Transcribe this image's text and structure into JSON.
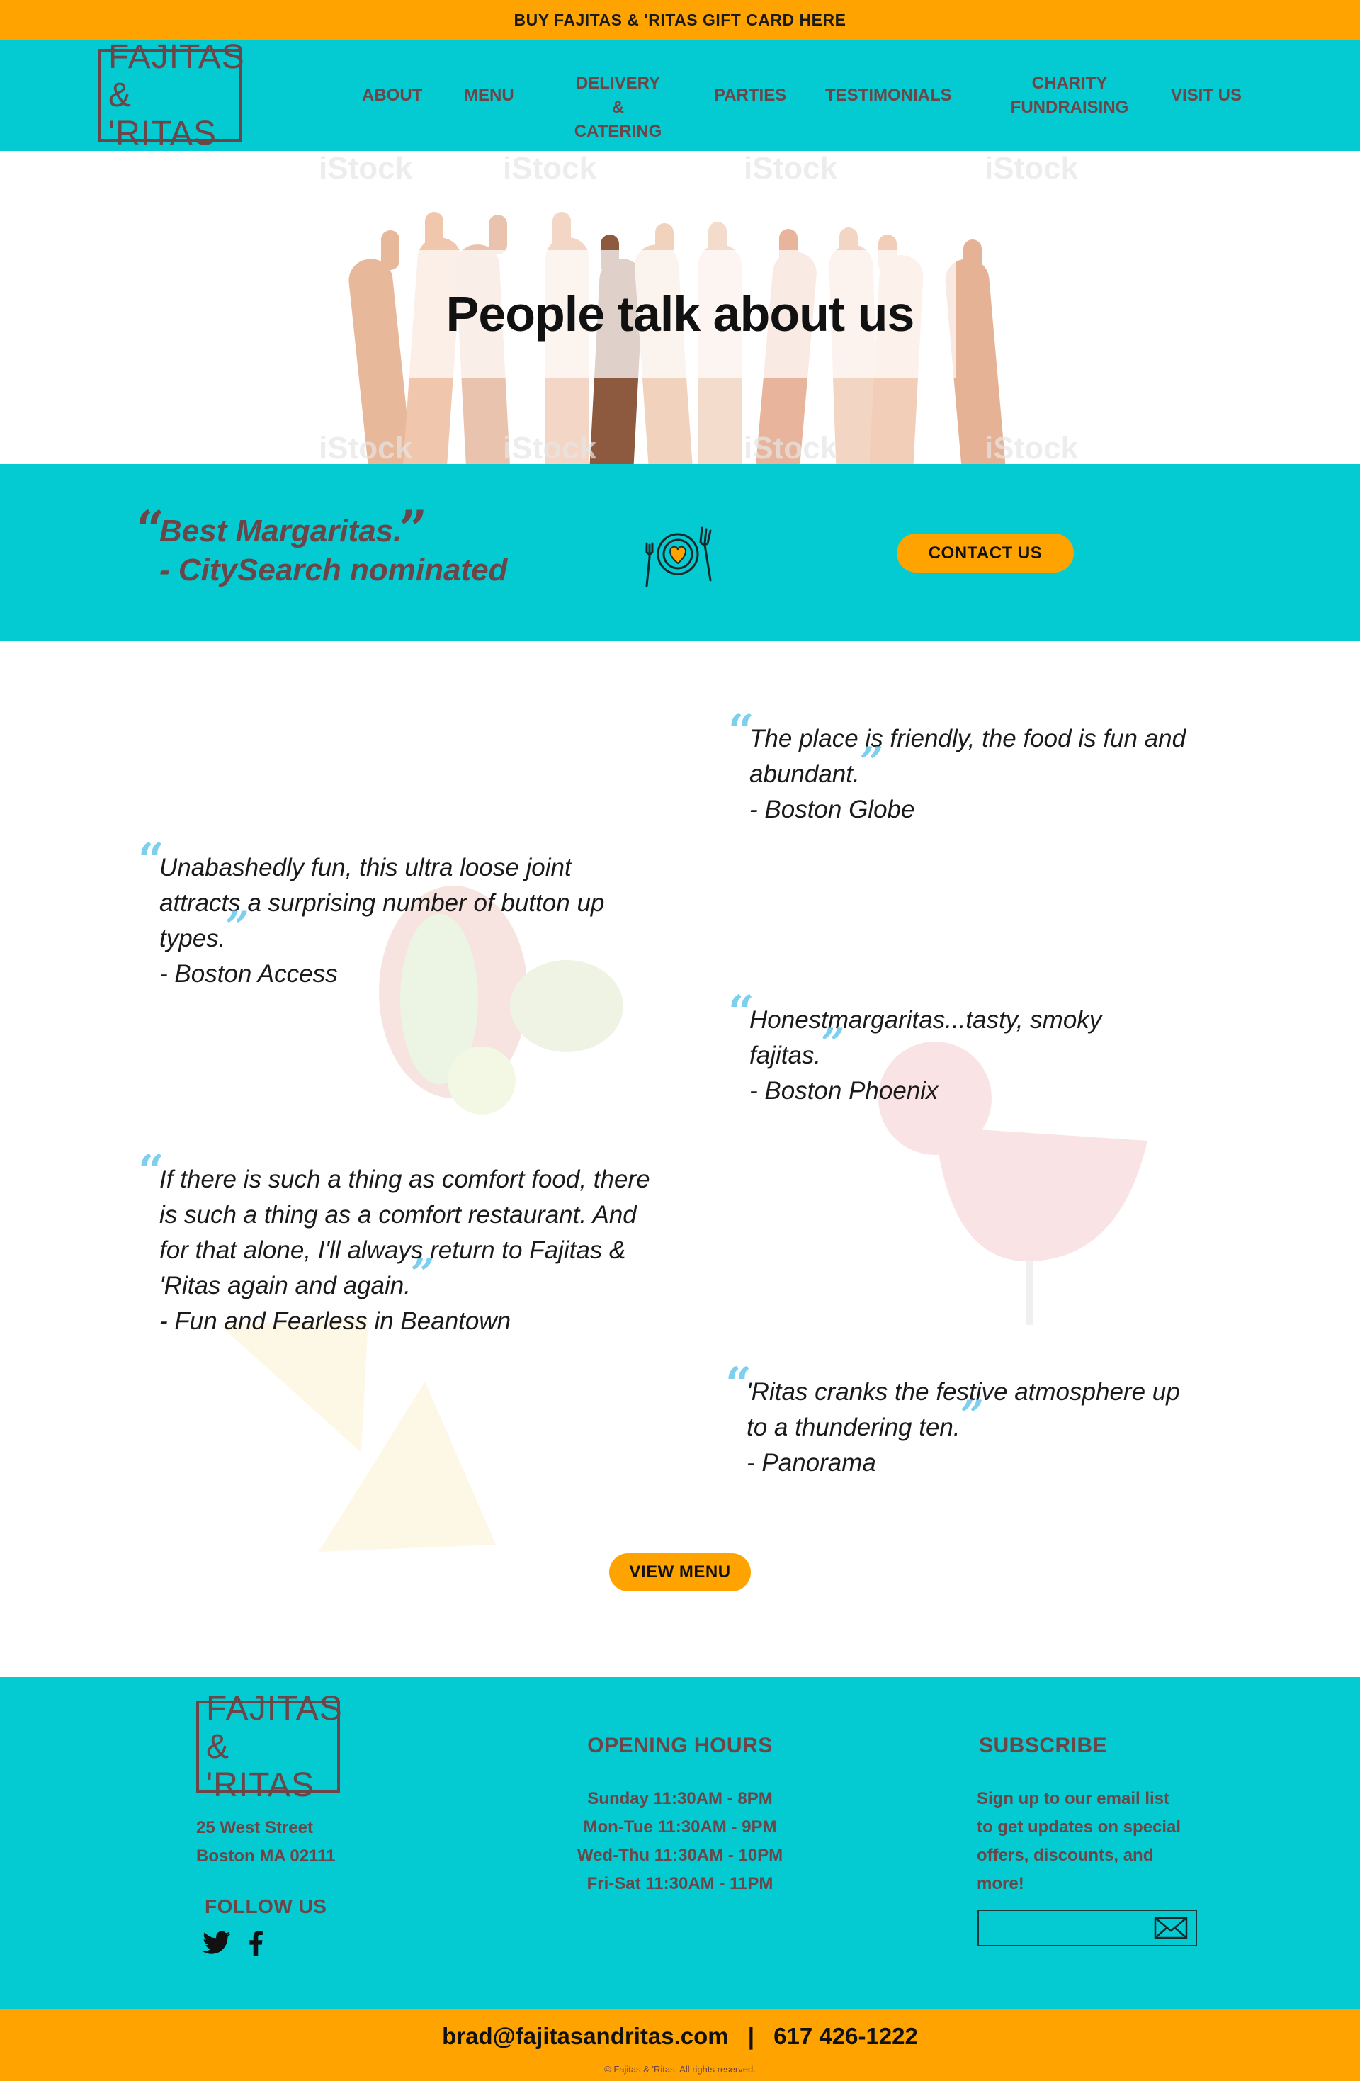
{
  "top_bar": {
    "gift_card_link": "BUY FAJITAS & 'RITAS GIFT CARD HERE"
  },
  "logo": {
    "line1": "FAJITAS",
    "line2": "& 'RITAS"
  },
  "nav": {
    "about": "ABOUT",
    "menu": "MENU",
    "delivery_line1": "DELIVERY",
    "delivery_line2": "& CATERING",
    "parties": "PARTIES",
    "testimonials": "TESTIMONIALS",
    "charity_line1": "CHARITY",
    "charity_line2": "FUNDRAISING",
    "visit": "VISIT US"
  },
  "hero": {
    "title": "People talk about us",
    "watermark": "iStock"
  },
  "banner": {
    "quote_line1": "Best Margaritas.",
    "quote_line2": "- CitySearch nominated",
    "contact_button": "CONTACT US",
    "icon": "plate-heart-icon"
  },
  "testimonials": [
    {
      "text": "The place is friendly, the food is fun and abundant.",
      "source": "- Boston Globe"
    },
    {
      "text": "Unabashedly fun, this ultra loose joint attracts a surprising number of button up types.",
      "source": "- Boston Access"
    },
    {
      "text": "Honestmargaritas...tasty, smoky fajitas.",
      "source": "- Boston Phoenix"
    },
    {
      "text": "If there is such a thing as comfort food, there is such a thing as a comfort restaurant. And for that alone, I'll always return to Fajitas & 'Ritas again and again.",
      "source": "- Fun and Fearless in Beantown"
    },
    {
      "text": "'Ritas cranks the festive atmosphere up to a thundering ten.",
      "source": "- Panorama"
    }
  ],
  "view_menu_button": "VIEW MENU",
  "footer": {
    "logo_line1": "FAJITAS",
    "logo_line2": "& 'RITAS",
    "address_line1": "25 West Street",
    "address_line2": "Boston MA 02111",
    "follow_title": "FOLLOW US",
    "hours_title": "OPENING HOURS",
    "hours": [
      "Sunday 11:30AM - 8PM",
      "Mon-Tue 11:30AM - 9PM",
      "Wed-Thu 11:30AM - 10PM",
      "Fri-Sat 11:30AM - 11PM"
    ],
    "subscribe_title": "SUBSCRIBE",
    "subscribe_text": [
      "Sign up to our email list",
      "to get updates on special",
      "offers, discounts, and",
      "more!"
    ],
    "email_placeholder": ""
  },
  "bottom_bar": {
    "email": "brad@fajitasandritas.com",
    "separator": "|",
    "phone": "617 426-1222",
    "copyright": "© Fajitas & 'Ritas. All rights reserved."
  },
  "colors": {
    "teal": "#03cbd1",
    "orange": "#ffa300",
    "brown": "#6b4547",
    "quote_blue": "#7ecfee"
  }
}
